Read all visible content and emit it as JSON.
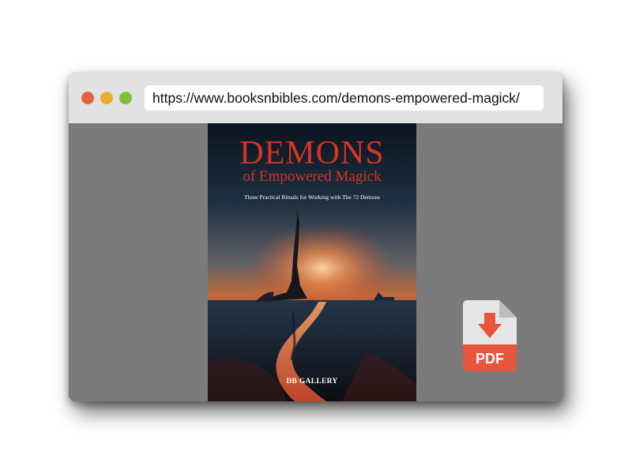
{
  "browser": {
    "url": "https://www.booksnbibles.com/demons-empowered-magick/",
    "traffic_lights": {
      "close": "#e8613f",
      "minimize": "#e8ad2c",
      "maximize": "#7dc13b"
    }
  },
  "book": {
    "title": "DEMONS",
    "subtitle": "of Empowered Magick",
    "tagline": "Three Practical Rituals for Working with The 72 Demons",
    "author": "DB GALLERY",
    "title_color": "#d8331f"
  },
  "download": {
    "label": "PDF",
    "icon": "pdf-download-icon",
    "accent_color": "#e8553d"
  }
}
